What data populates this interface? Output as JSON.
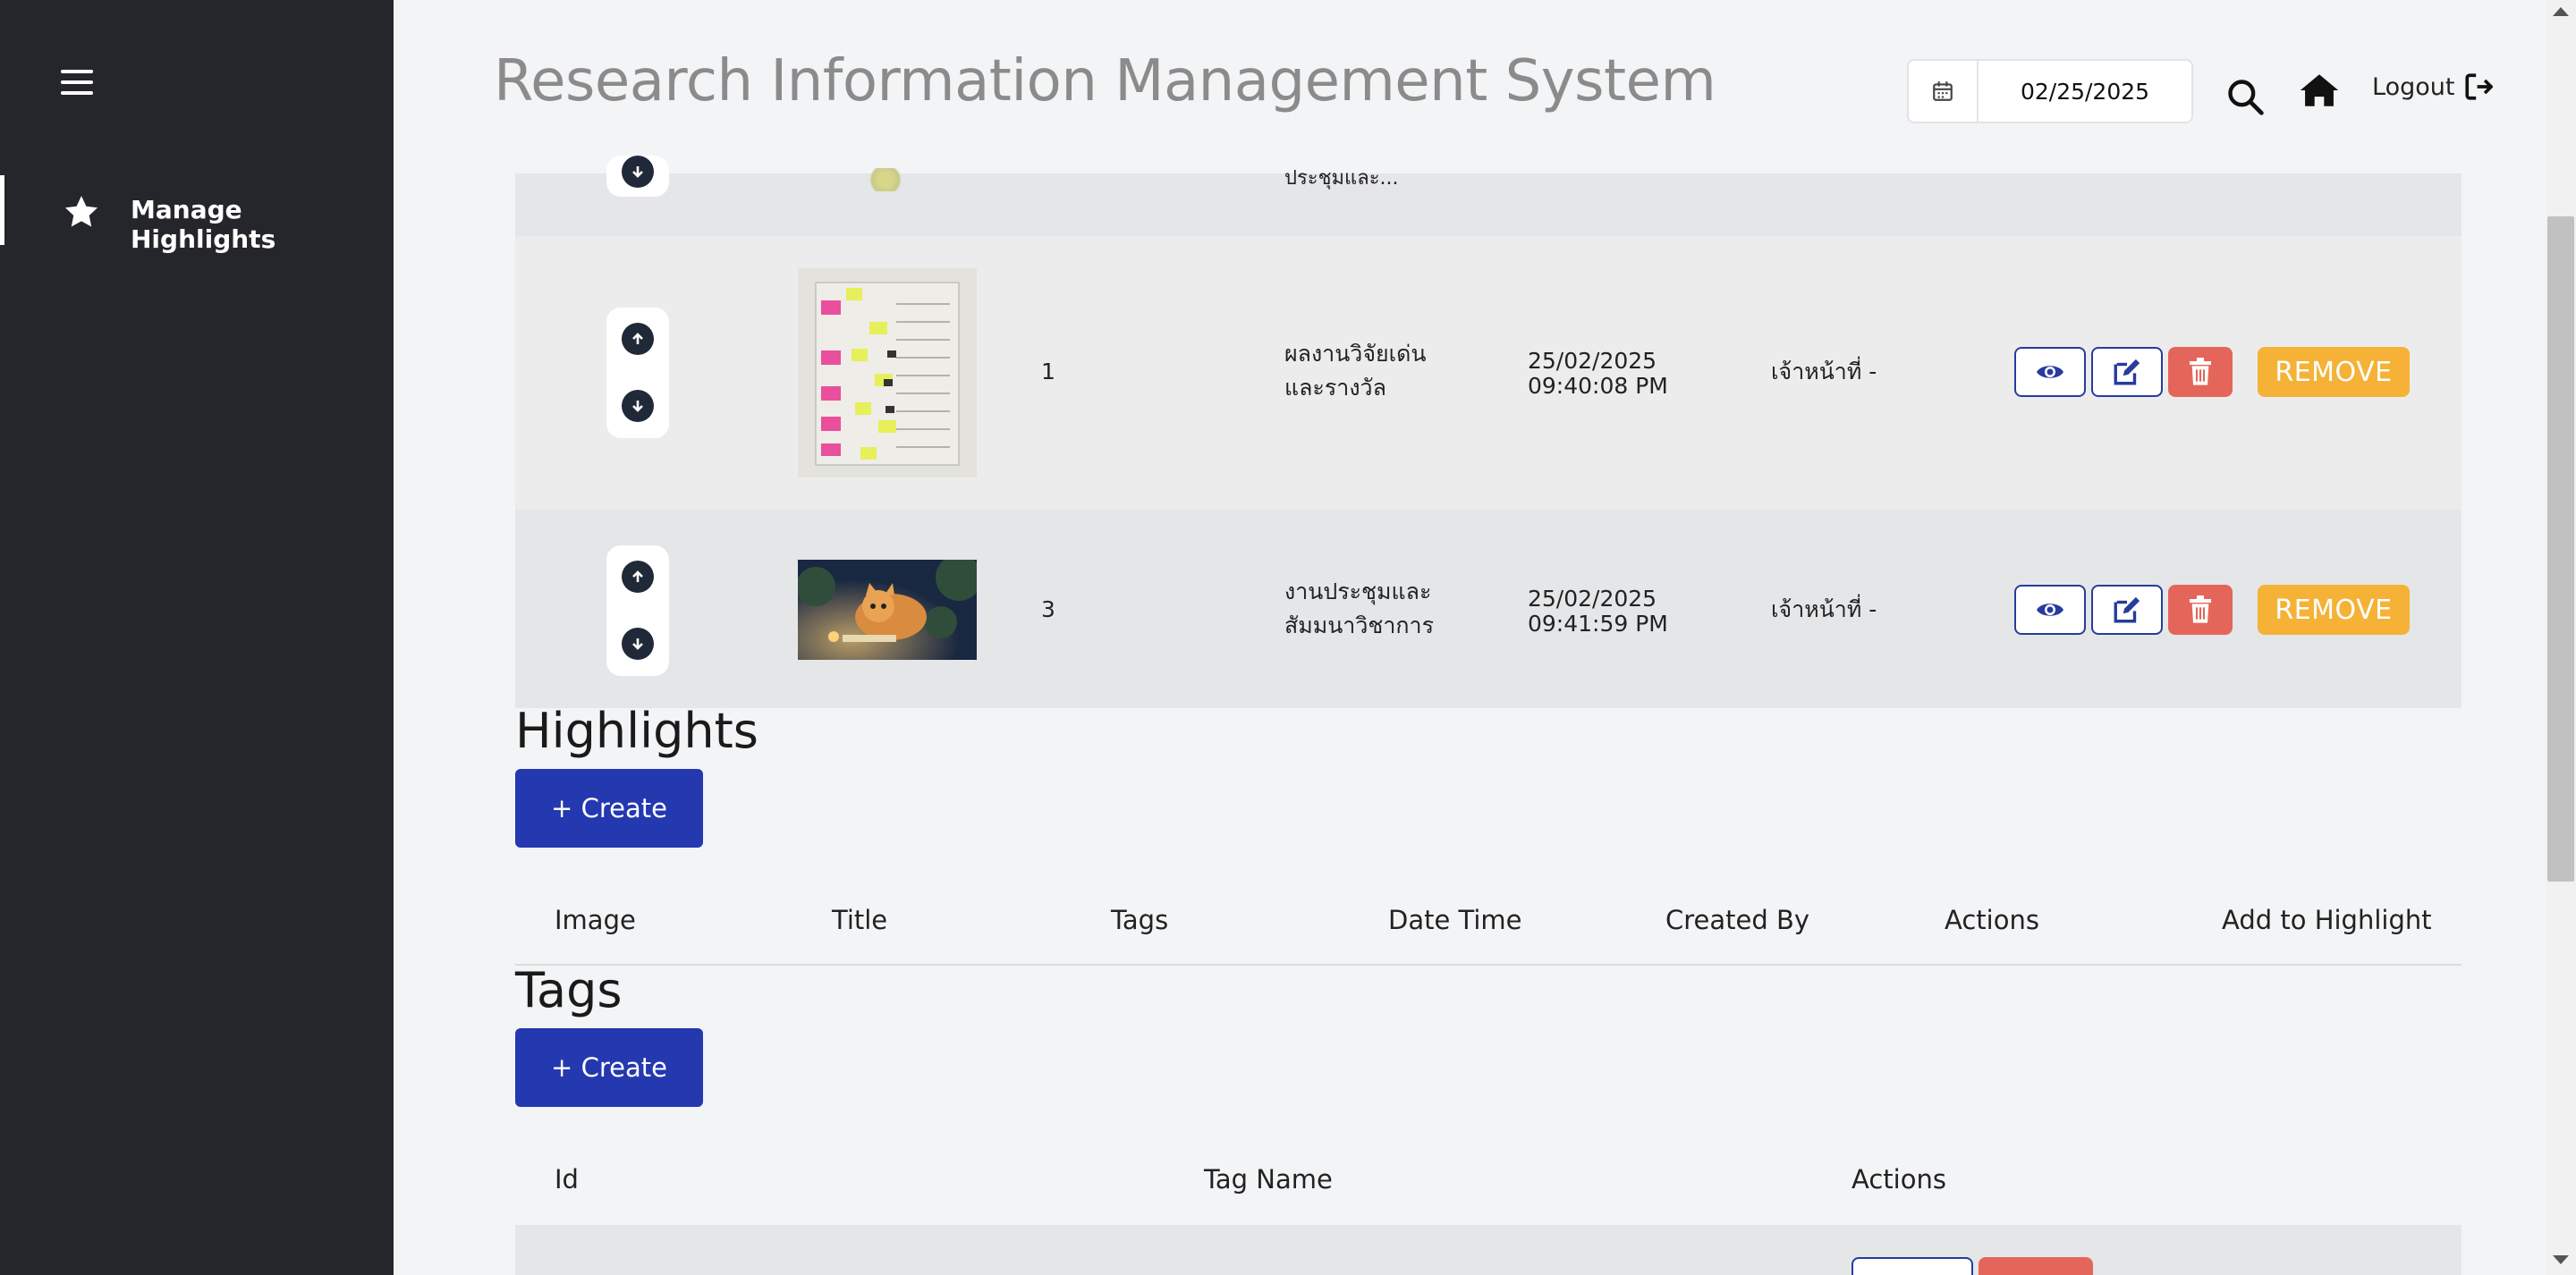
{
  "sidebar": {
    "menu_icon": "hamburger-icon",
    "items": [
      {
        "label": "Manage Highlights",
        "icon": "star-icon"
      }
    ]
  },
  "header": {
    "title": "Research Information Management System",
    "date_value": "02/25/2025",
    "logout_label": "Logout"
  },
  "highlight_rows": [
    {
      "order": "",
      "title": "ประชุมและ...",
      "datetime_date": "",
      "datetime_time": "",
      "created_by": ""
    },
    {
      "order": "1",
      "title_line1": "ผลงานวิจัยเด่น",
      "title_line2": "และรางวัล",
      "datetime_date": "25/02/2025",
      "datetime_time": "09:40:08 PM",
      "created_by": "เจ้าหน้าที่ -",
      "remove_label": "REMOVE"
    },
    {
      "order": "3",
      "title_line1": "งานประชุมและ",
      "title_line2": "สัมมนาวิชาการ",
      "datetime_date": "25/02/2025",
      "datetime_time": "09:41:59 PM",
      "created_by": "เจ้าหน้าที่ -",
      "remove_label": "REMOVE"
    }
  ],
  "highlights_section": {
    "title": "Highlights",
    "create_label": "+ Create",
    "columns": [
      "Image",
      "Title",
      "Tags",
      "Date Time",
      "Created By",
      "Actions",
      "Add to Highlight"
    ]
  },
  "tags_section": {
    "title": "Tags",
    "create_label": "+ Create",
    "columns": [
      "Id",
      "Tag Name",
      "Actions"
    ]
  },
  "colors": {
    "sidebar_bg": "#25262b",
    "primary": "#2438b0",
    "danger": "#e4665a",
    "warning": "#f5b236"
  }
}
